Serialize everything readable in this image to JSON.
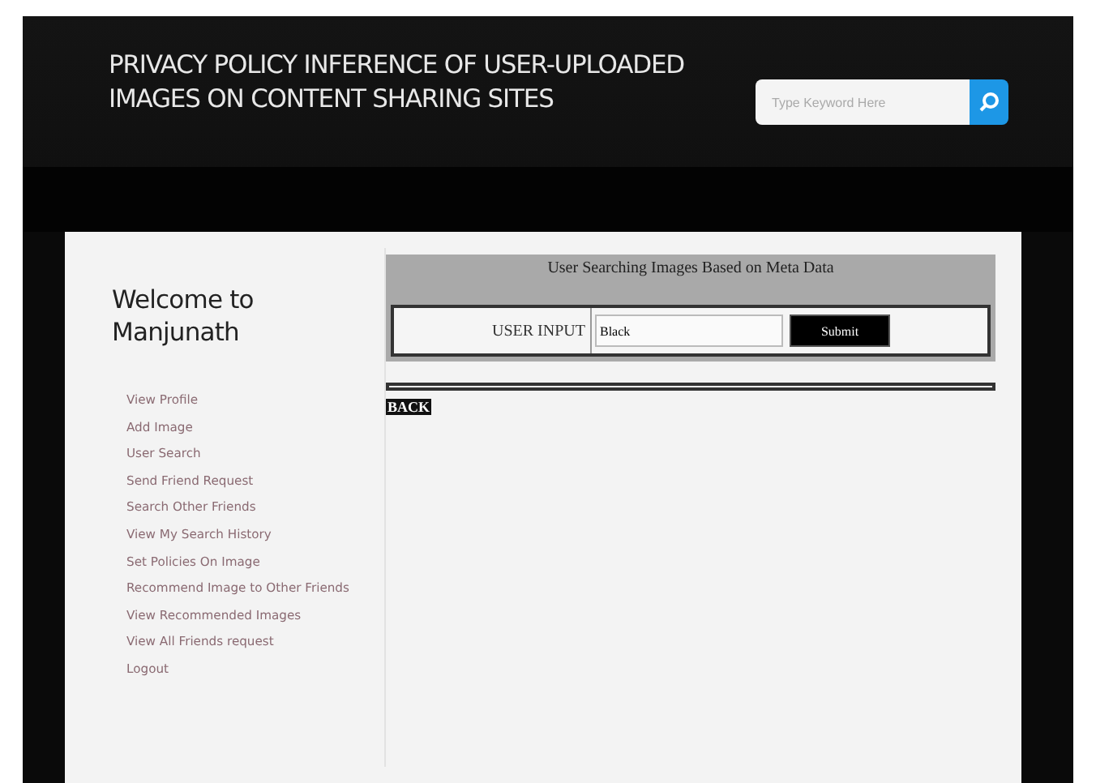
{
  "header": {
    "title_lines": [
      "PRIVACY POLICY INFERENCE OF USER-UPLOADED",
      "IMAGES ON CONTENT SHARING SITES"
    ],
    "search": {
      "placeholder": "Type Keyword Here"
    }
  },
  "sidebar": {
    "welcome_lines": [
      "Welcome to",
      "Manjunath"
    ],
    "items": [
      "View Profile",
      "Add Image",
      "User Search",
      "Send Friend Request",
      "Search Other Friends",
      "View My Search History",
      "Set Policies On Image",
      "Recommend Image to Other Friends",
      "View Recommended Images",
      "View All Friends request",
      "Logout"
    ]
  },
  "form": {
    "title": "User Searching Images Based on Meta Data",
    "label": "USER INPUT",
    "value": "Black",
    "submit": "Submit"
  },
  "back": "BACK"
}
